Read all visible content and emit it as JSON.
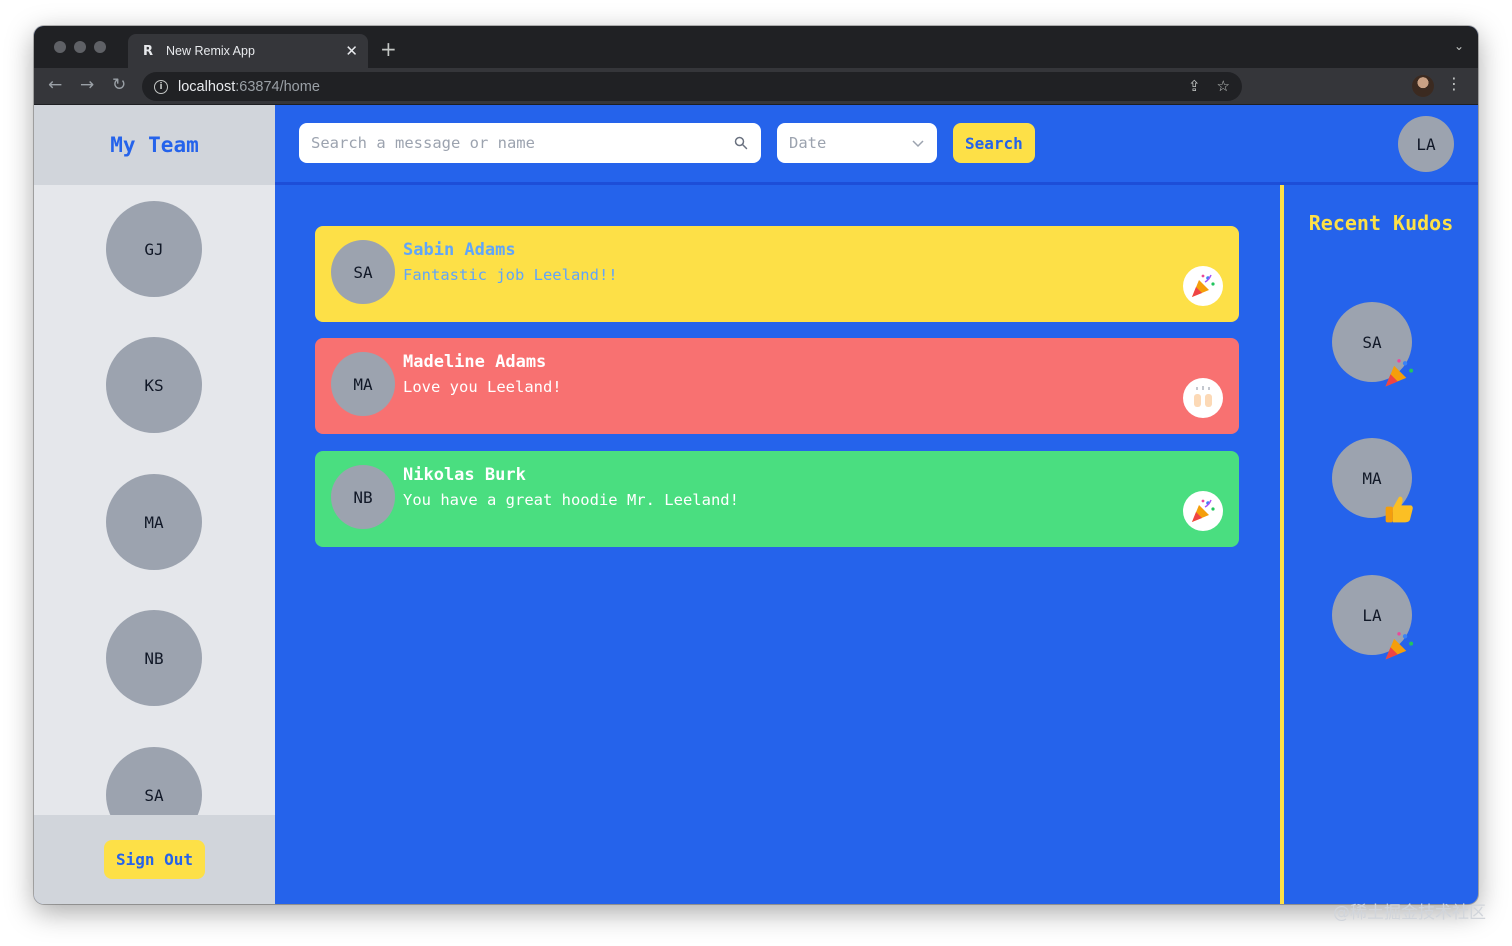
{
  "browser": {
    "tab_title": "New Remix App",
    "tab_favicon": "R",
    "url_host": "localhost",
    "url_rest": ":63874/home"
  },
  "sidebar": {
    "title": "My Team",
    "members": [
      "GJ",
      "KS",
      "MA",
      "NB",
      "SA"
    ],
    "sign_out_label": "Sign Out"
  },
  "topbar": {
    "search_placeholder": "Search a message or name",
    "date_label": "Date",
    "search_button": "Search",
    "user_initials": "LA"
  },
  "kudos": [
    {
      "initials": "SA",
      "name": "Sabin Adams",
      "message": "Fantastic job Leeland!!",
      "emoji": "party-popper",
      "bg": "#fde047",
      "text": "#60a5fa"
    },
    {
      "initials": "MA",
      "name": "Madeline Adams",
      "message": "Love you Leeland!",
      "emoji": "raising-hands",
      "bg": "#f87171",
      "text": "#ffffff"
    },
    {
      "initials": "NB",
      "name": "Nikolas Burk",
      "message": "You have a great hoodie Mr. Leeland!",
      "emoji": "party-popper",
      "bg": "#4ade80",
      "text": "#ffffff"
    }
  ],
  "recent_kudos": {
    "title": "Recent Kudos",
    "items": [
      {
        "initials": "SA",
        "emoji": "party-popper"
      },
      {
        "initials": "MA",
        "emoji": "thumbs-up"
      },
      {
        "initials": "LA",
        "emoji": "party-popper"
      }
    ]
  },
  "colors": {
    "primary_blue": "#2563eb",
    "accent_yellow": "#fde047",
    "avatar_gray": "#9ca3af"
  },
  "watermark": "@稀土掘金技术社区"
}
